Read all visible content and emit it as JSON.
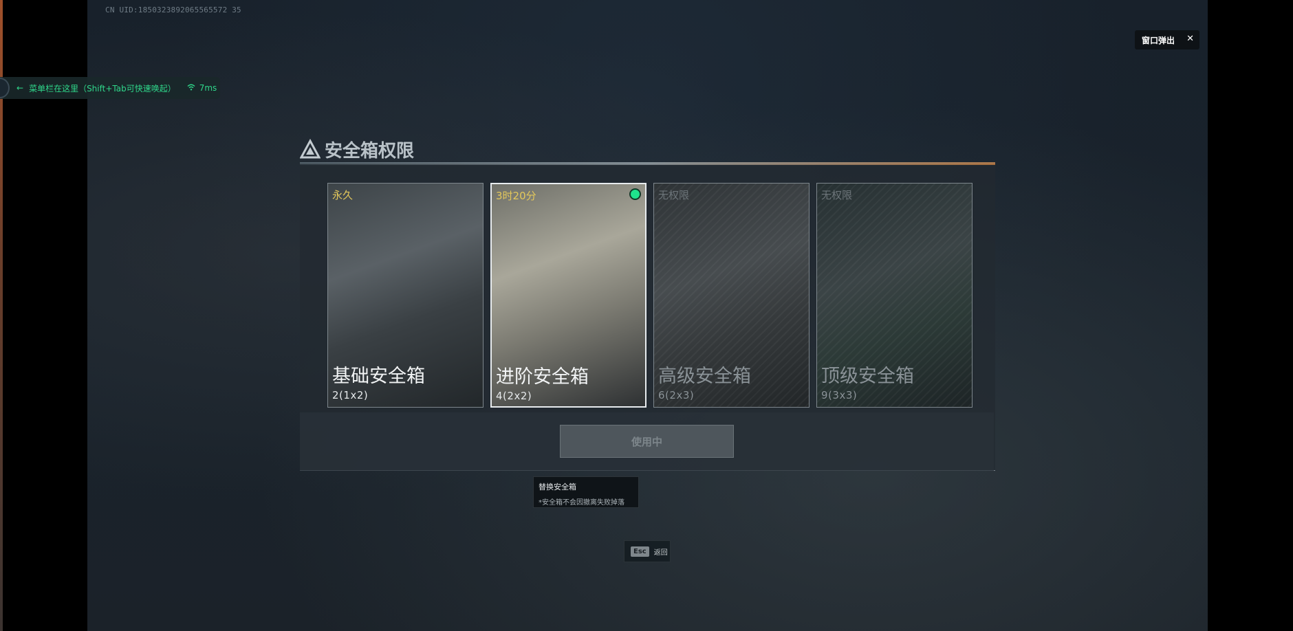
{
  "uid_text": "CN UID:1850323892065565572 35",
  "window_popout": {
    "label": "窗口弹出",
    "close_icon": "close-icon"
  },
  "menu_hint": {
    "text": "菜单栏在这里（Shift+Tab可快速唤起）",
    "ping": "7ms",
    "arrow_icon": "arrow-left-icon",
    "wifi_icon": "wifi-icon"
  },
  "panel": {
    "title": "安全箱权限",
    "title_icon": "triangle-warning-icon",
    "cards": [
      {
        "time": "永久",
        "name": "基础安全箱",
        "capacity": "2(1x2)",
        "state": "unlocked",
        "selected": false
      },
      {
        "time": "3时20分",
        "name": "进阶安全箱",
        "capacity": "4(2x2)",
        "state": "unlocked",
        "selected": true
      },
      {
        "time": "无权限",
        "name": "高级安全箱",
        "capacity": "6(2x3)",
        "state": "locked",
        "selected": false
      },
      {
        "time": "无权限",
        "name": "顶级安全箱",
        "capacity": "9(3x3)",
        "state": "locked",
        "selected": false
      }
    ],
    "action_button": "使用中"
  },
  "tooltip": {
    "title": "替换安全箱",
    "note": "*安全箱不会因撤离失败掉落"
  },
  "esc_hint": {
    "key": "Esc",
    "label": "返回"
  },
  "colors": {
    "accent_green": "#2fd88b",
    "timer_yellow": "#e5c95b",
    "active_dot": "#1fe28c"
  }
}
